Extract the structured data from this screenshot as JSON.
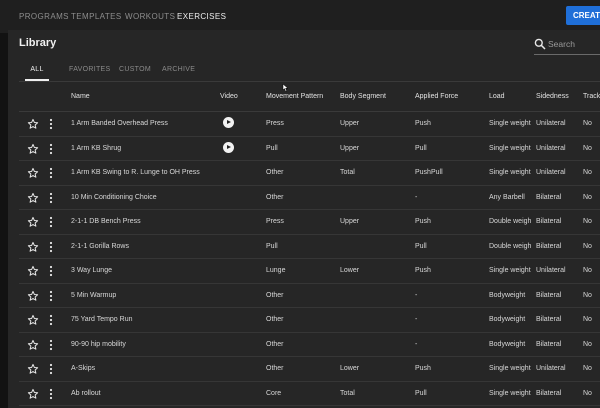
{
  "topnav": {
    "tabs": [
      "PROGRAMS",
      "TEMPLATES",
      "WORKOUTS",
      "EXERCISES"
    ],
    "active_tab": "EXERCISES",
    "create_label": "CREATE"
  },
  "library": {
    "title": "Library",
    "search_placeholder": "Search",
    "subtabs": [
      "ALL",
      "FAVORITES",
      "CUSTOM",
      "ARCHIVE"
    ],
    "active_subtab": "ALL"
  },
  "table": {
    "columns": [
      "Name",
      "Video",
      "Movement Pattern",
      "Body Segment",
      "Applied Force",
      "Load",
      "Sidedness",
      "Track"
    ],
    "rows": [
      {
        "name": "1 Arm Banded Overhead Press",
        "video": true,
        "pattern": "Press",
        "segment": "Upper",
        "force": "Push",
        "load": "Single weight",
        "sidedness": "Unilateral",
        "track": "No"
      },
      {
        "name": "1 Arm KB Shrug",
        "video": true,
        "pattern": "Pull",
        "segment": "Upper",
        "force": "Pull",
        "load": "Single weight",
        "sidedness": "Unilateral",
        "track": "No"
      },
      {
        "name": "1 Arm KB Swing to R. Lunge to OH Press",
        "video": false,
        "pattern": "Other",
        "segment": "Total",
        "force": "PushPull",
        "load": "Single weight",
        "sidedness": "Unilateral",
        "track": "No"
      },
      {
        "name": "10 Min Conditioning Choice",
        "video": false,
        "pattern": "Other",
        "segment": "",
        "force": "-",
        "load": "Any Barbell",
        "sidedness": "Bilateral",
        "track": "No"
      },
      {
        "name": "2-1-1 DB Bench Press",
        "video": false,
        "pattern": "Press",
        "segment": "Upper",
        "force": "Push",
        "load": "Double weight",
        "sidedness": "Bilateral",
        "track": "No"
      },
      {
        "name": "2-1-1 Gorilla Rows",
        "video": false,
        "pattern": "Pull",
        "segment": "",
        "force": "Pull",
        "load": "Double weight",
        "sidedness": "Bilateral",
        "track": "No"
      },
      {
        "name": "3 Way Lunge",
        "video": false,
        "pattern": "Lunge",
        "segment": "Lower",
        "force": "Push",
        "load": "Single weight",
        "sidedness": "Unilateral",
        "track": "No"
      },
      {
        "name": "5 Min Warmup",
        "video": false,
        "pattern": "Other",
        "segment": "",
        "force": "-",
        "load": "Bodyweight",
        "sidedness": "Bilateral",
        "track": "No"
      },
      {
        "name": "75 Yard Tempo Run",
        "video": false,
        "pattern": "Other",
        "segment": "",
        "force": "-",
        "load": "Bodyweight",
        "sidedness": "Bilateral",
        "track": "No"
      },
      {
        "name": "90-90 hip mobility",
        "video": false,
        "pattern": "Other",
        "segment": "",
        "force": "-",
        "load": "Bodyweight",
        "sidedness": "Bilateral",
        "track": "No"
      },
      {
        "name": "A-Skips",
        "video": false,
        "pattern": "Other",
        "segment": "Lower",
        "force": "Push",
        "load": "Single weight",
        "sidedness": "Unilateral",
        "track": "No"
      },
      {
        "name": "Ab rollout",
        "video": false,
        "pattern": "Core",
        "segment": "Total",
        "force": "Pull",
        "load": "Single weight",
        "sidedness": "Bilateral",
        "track": "No"
      }
    ]
  },
  "icons": {
    "search": "search-icon",
    "favorite": "star-outline-icon",
    "more": "kebab-menu-icon",
    "video": "play-circle-icon"
  },
  "colors": {
    "accent": "#1f6fd8",
    "background": "#121212",
    "panel": "#262626"
  }
}
